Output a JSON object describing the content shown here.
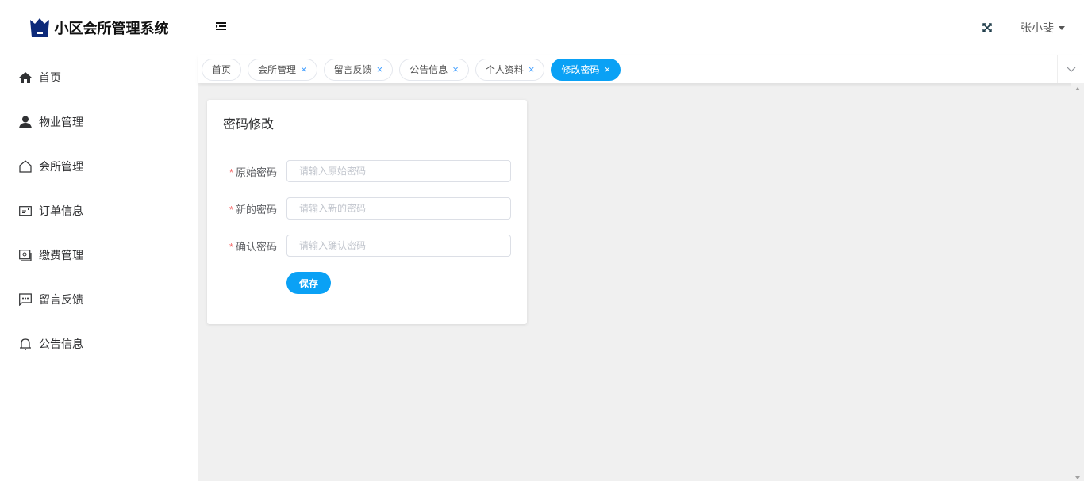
{
  "app": {
    "title": "小区会所管理系统"
  },
  "header": {
    "user_name": "张小斐"
  },
  "sidebar": {
    "items": [
      {
        "label": "首页",
        "icon": "home-icon"
      },
      {
        "label": "物业管理",
        "icon": "user-icon"
      },
      {
        "label": "会所管理",
        "icon": "house-outline-icon"
      },
      {
        "label": "订单信息",
        "icon": "ticket-icon"
      },
      {
        "label": "缴费管理",
        "icon": "wallet-icon"
      },
      {
        "label": "留言反馈",
        "icon": "chat-icon"
      },
      {
        "label": "公告信息",
        "icon": "bell-icon"
      }
    ]
  },
  "tabs": [
    {
      "label": "首页",
      "closable": false,
      "active": false
    },
    {
      "label": "会所管理",
      "closable": true,
      "active": false
    },
    {
      "label": "留言反馈",
      "closable": true,
      "active": false
    },
    {
      "label": "公告信息",
      "closable": true,
      "active": false
    },
    {
      "label": "个人资料",
      "closable": true,
      "active": false
    },
    {
      "label": "修改密码",
      "closable": true,
      "active": true
    }
  ],
  "form": {
    "title": "密码修改",
    "fields": [
      {
        "label": "原始密码",
        "placeholder": "请输入原始密码",
        "value": ""
      },
      {
        "label": "新的密码",
        "placeholder": "请输入新的密码",
        "value": ""
      },
      {
        "label": "确认密码",
        "placeholder": "请输入确认密码",
        "value": ""
      }
    ],
    "required_mark": "*",
    "close_mark": "×",
    "save_label": "保存"
  },
  "colors": {
    "accent": "#0aa1f5",
    "logo": "#0d2a7a",
    "required": "#f56c6c"
  }
}
